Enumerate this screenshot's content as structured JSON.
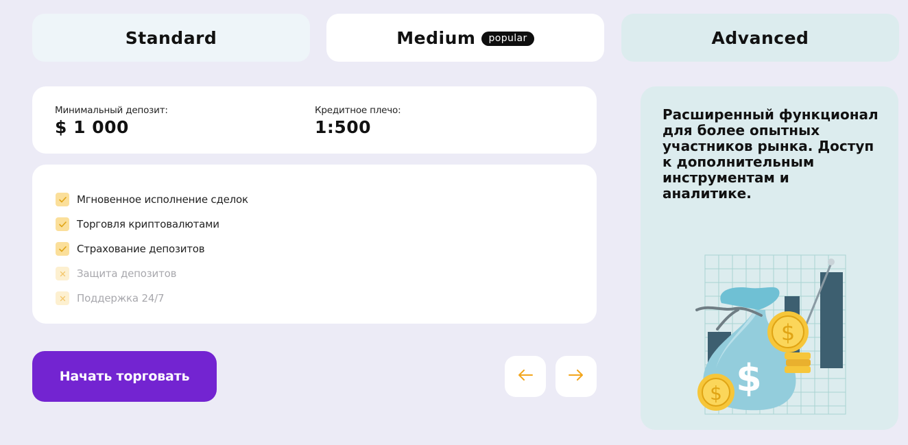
{
  "tabs": [
    {
      "label": "Standard"
    },
    {
      "label": "Medium",
      "badge": "popular"
    },
    {
      "label": "Advanced"
    }
  ],
  "info": {
    "deposit_label": "Минимальный депозит:",
    "deposit_value": "$ 1 000",
    "leverage_label": "Кредитное плечо:",
    "leverage_value": "1:500"
  },
  "features": [
    {
      "text": "Мгновенное исполнение сделок",
      "included": true
    },
    {
      "text": "Торговля криптовалютами",
      "included": true
    },
    {
      "text": "Страхование депозитов",
      "included": true
    },
    {
      "text": "Защита депозитов",
      "included": false
    },
    {
      "text": "Поддержка 24/7",
      "included": false
    }
  ],
  "cta_label": "Начать торговать",
  "nav": {
    "prev_icon": "arrow-left-icon",
    "next_icon": "arrow-right-icon"
  },
  "description": "Расширенный функционал для более опытных участников рынка. Доступ к дополнительным инструментам и аналитике.",
  "colors": {
    "background": "#ecebf6",
    "accent": "#7324d1",
    "check": "#fbdf9a",
    "arrow": "#f2a51a",
    "panel": "#dcecee"
  }
}
